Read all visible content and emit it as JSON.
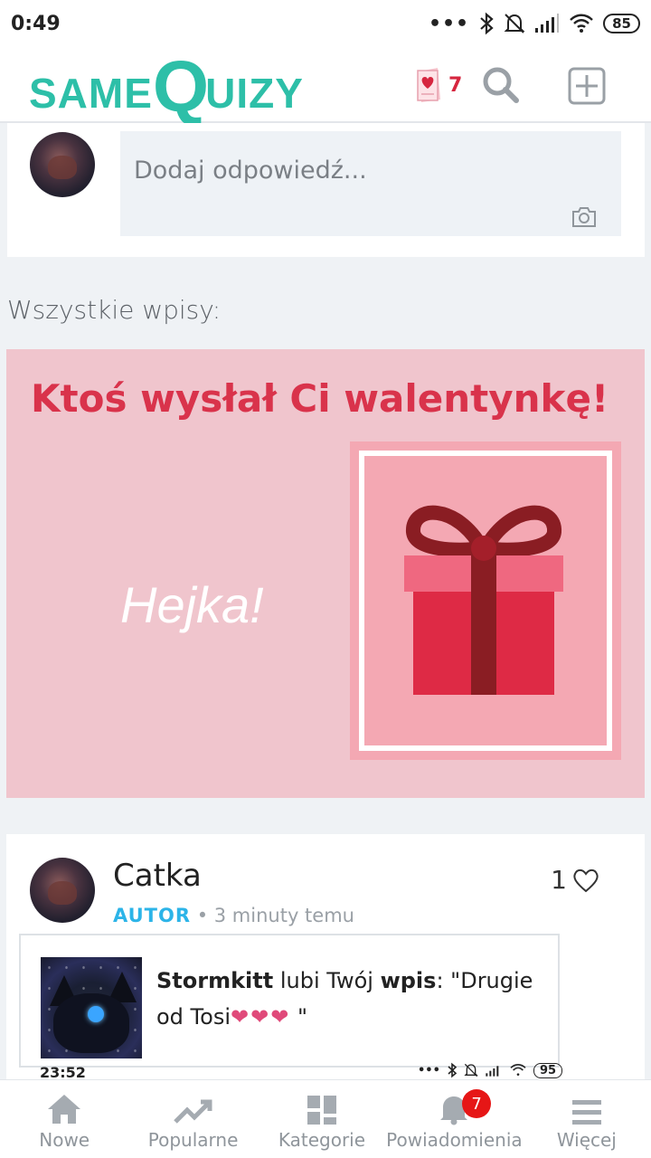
{
  "status_bar": {
    "time": "0:49",
    "battery": "85"
  },
  "header": {
    "logo": {
      "part1": "SAME",
      "part2": "Q",
      "part3": "UIZY"
    },
    "valentine_count": "7"
  },
  "composer": {
    "placeholder": "Dodaj odpowiedź..."
  },
  "feed": {
    "section_title": "Wszystkie wpisy:"
  },
  "valentine_card": {
    "title": "Ktoś wysłał Ci walentynkę!",
    "message": "Hejka!"
  },
  "post": {
    "author": "Catka",
    "role": "AUTOR",
    "time": "3 minuty temu",
    "likes": "1",
    "notification": {
      "user": "Stormkitt",
      "text1": " lubi Twój ",
      "object": "wpis",
      "text2": ": \"Drugie od Tosi",
      "hearts": "❤❤❤",
      "text3": " \""
    }
  },
  "overlay_status": {
    "time": "23:52",
    "battery": "95"
  },
  "bottom_nav": {
    "items": [
      {
        "label": "Nowe",
        "icon": "home-icon"
      },
      {
        "label": "Popularne",
        "icon": "trending-icon"
      },
      {
        "label": "Kategorie",
        "icon": "grid-icon"
      },
      {
        "label": "Powiadomienia",
        "icon": "bell-icon",
        "badge": "7"
      },
      {
        "label": "Więcej",
        "icon": "menu-icon"
      }
    ]
  },
  "colors": {
    "brand": "#2dbfa8",
    "accent": "#d9334b",
    "role": "#2cb4e8",
    "card_bg": "#f0c5cd"
  }
}
